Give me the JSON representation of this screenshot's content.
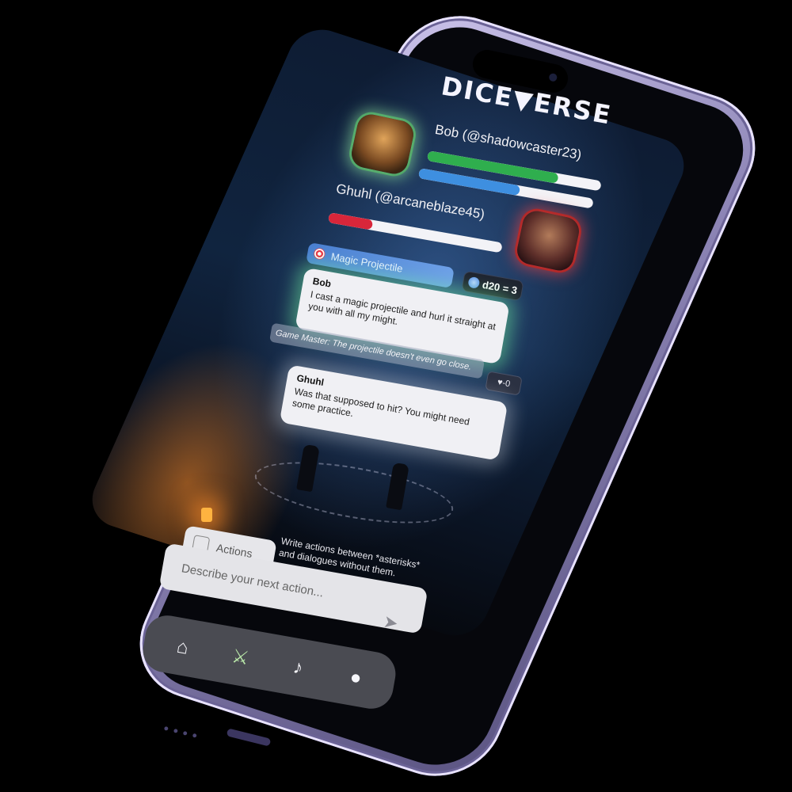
{
  "app": {
    "logo_text": "DICE▼ERSE"
  },
  "players": [
    {
      "name": "Bob (@shadowcaster23)",
      "hp_fraction": 0.75,
      "mp_fraction": 0.58,
      "hp_color": "#2fae4e",
      "mp_color": "#3e8fe0"
    },
    {
      "name": "Ghuhl (@arcaneblaze45)",
      "hp_fraction": 0.25,
      "hp_color": "#d8263a"
    }
  ],
  "ability": {
    "label": "Magic Projectile",
    "icon": "target-icon"
  },
  "roll": {
    "text": "d20 = 3",
    "icon": "d20-icon"
  },
  "messages": [
    {
      "sender": "Bob",
      "text": "I cast a magic projectile and hurl it straight at you with all my might."
    },
    {
      "sender": "Ghuhl",
      "text": "Was that supposed to hit? You might need some practice."
    }
  ],
  "game_master": {
    "text": "Game Master: The projectile doesn't even go close.",
    "modifier": "-0"
  },
  "actions": {
    "button_label": "Actions",
    "hint": "Write actions between *asterisks* and dialogues without them.",
    "input_placeholder": "Describe your next action..."
  },
  "nav": [
    {
      "name": "home",
      "icon": "home-icon",
      "glyph": "⌂"
    },
    {
      "name": "battle",
      "icon": "crossed-swords-icon",
      "glyph": "⚔"
    },
    {
      "name": "notifications",
      "icon": "bell-icon",
      "glyph": "♪"
    },
    {
      "name": "profile",
      "icon": "user-icon",
      "glyph": "●"
    }
  ]
}
